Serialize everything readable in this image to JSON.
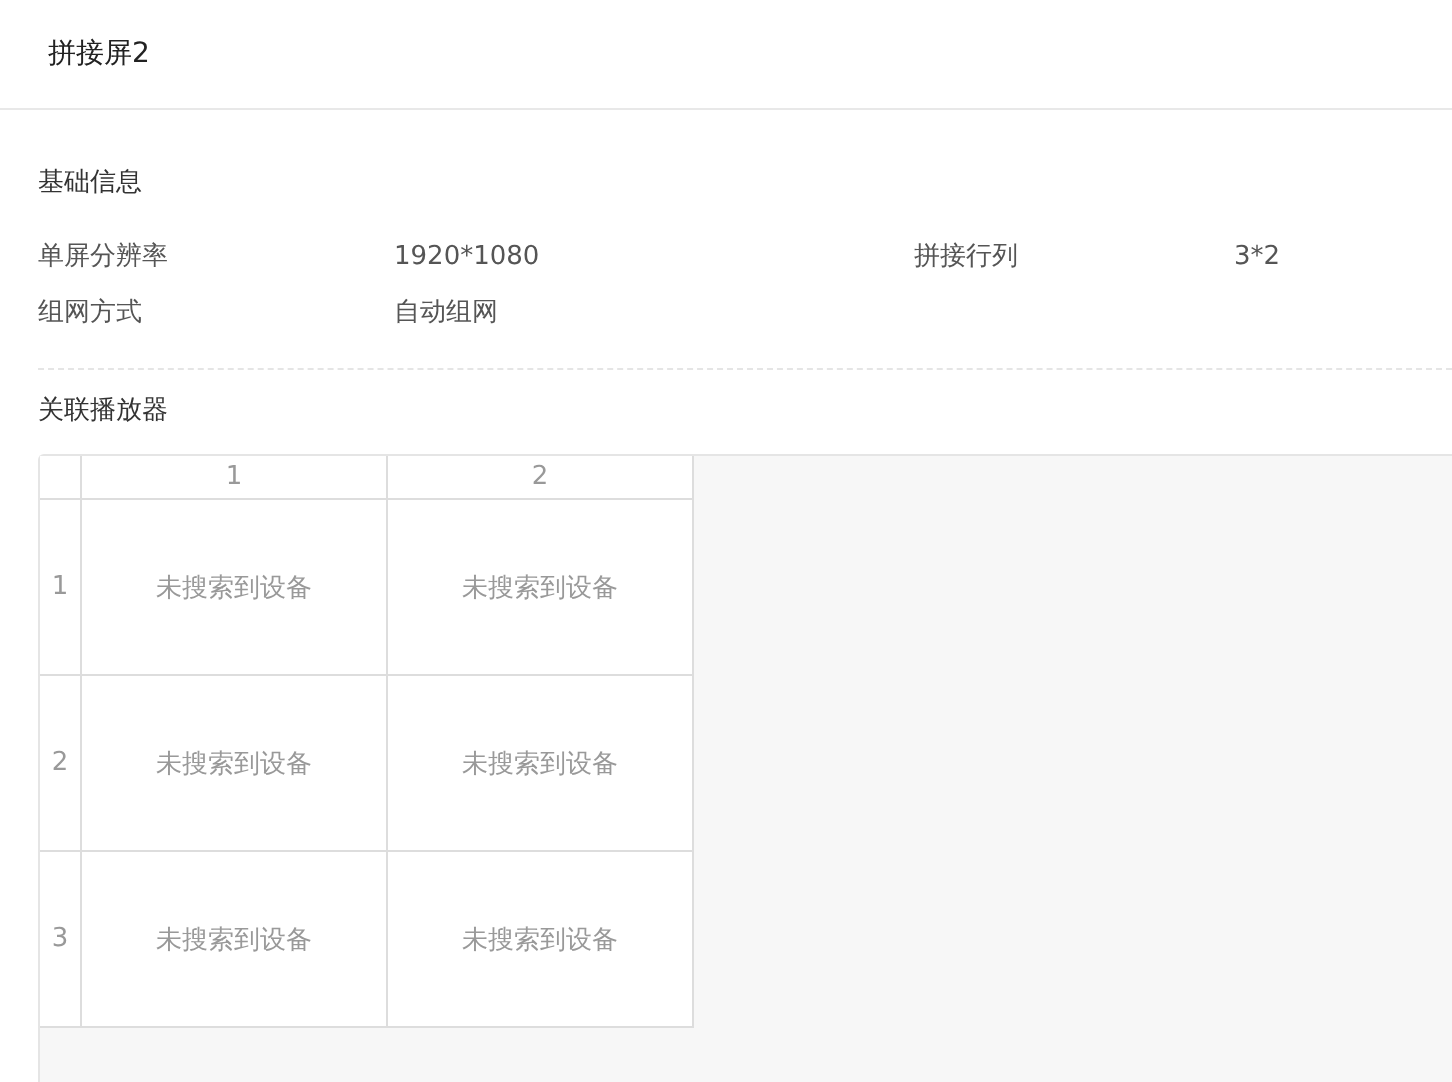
{
  "title": "拼接屏2",
  "basic_info": {
    "heading": "基础信息",
    "fields": [
      {
        "label": "单屏分辨率",
        "value": "1920*1080"
      },
      {
        "label": "拼接行列",
        "value": "3*2"
      },
      {
        "label": "组网方式",
        "value": "自动组网"
      }
    ]
  },
  "players": {
    "heading": "关联播放器",
    "columns": [
      "1",
      "2"
    ],
    "rows": [
      {
        "label": "1",
        "cells": [
          "未搜索到设备",
          "未搜索到设备"
        ]
      },
      {
        "label": "2",
        "cells": [
          "未搜索到设备",
          "未搜索到设备"
        ]
      },
      {
        "label": "3",
        "cells": [
          "未搜索到设备",
          "未搜索到设备"
        ]
      }
    ]
  }
}
